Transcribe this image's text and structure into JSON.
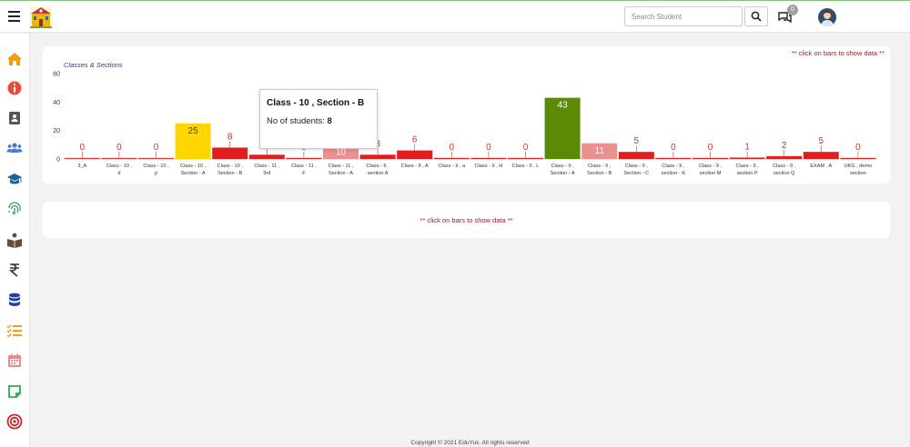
{
  "search": {
    "placeholder": "Search Student"
  },
  "notifications": {
    "count": "0"
  },
  "sidebar": {
    "items": [
      {
        "icon": "home-icon",
        "color": "#f39c12"
      },
      {
        "icon": "info-icon",
        "color": "#e74c3c"
      },
      {
        "icon": "contact-book-icon",
        "color": "#555555"
      },
      {
        "icon": "users-icon",
        "color": "#4a7cc9"
      },
      {
        "icon": "graduation-cap-icon",
        "color": "#1d5f9c"
      },
      {
        "icon": "fingerprint-icon",
        "color": "#2eaa4a"
      },
      {
        "icon": "book-reader-icon",
        "color": "#6b4a3a"
      },
      {
        "icon": "rupee-icon",
        "color": "#333333"
      },
      {
        "icon": "database-icon",
        "color": "#1f3fa6"
      },
      {
        "icon": "checklist-icon",
        "color": "#f0a11c"
      },
      {
        "icon": "calendar-icon",
        "color": "#e88c8c"
      },
      {
        "icon": "sticky-note-icon",
        "color": "#2eaa4a"
      },
      {
        "icon": "target-icon",
        "color": "#c62828"
      }
    ]
  },
  "card1": {
    "hint": "** click on bars to show data **"
  },
  "card2": {
    "hint": "** click on bars to show data **"
  },
  "tooltip": {
    "title": "Class - 10 , Section - B",
    "label": "No of students:",
    "value": "8"
  },
  "footer": {
    "text": "Copyright © 2021 EduYux. All rights reserved"
  },
  "chart_data": {
    "type": "bar",
    "title": "Classes & Sections",
    "ylim": [
      0,
      60
    ],
    "yticks": [
      0,
      20,
      40,
      60
    ],
    "categories": [
      [
        "3_A"
      ],
      [
        "Class - 10 ,",
        "d"
      ],
      [
        "Class - 10 ,",
        "p"
      ],
      [
        "Class - 10 ,",
        "Section - A"
      ],
      [
        "Class - 10 ,",
        "Section - B"
      ],
      [
        "Class - 11 ,",
        "3rd"
      ],
      [
        "Class - 11 ,",
        "F"
      ],
      [
        "Class - 11 ,",
        "Section - A"
      ],
      [
        "Class - 6 ,",
        "section A"
      ],
      [
        "Class - 8 , A"
      ],
      [
        "Class - 9 , a"
      ],
      [
        "Class - 9 , H"
      ],
      [
        "Class - 9 , L"
      ],
      [
        "Class - 9 ,",
        "Section - A"
      ],
      [
        "Class - 9 ,",
        "Section - B"
      ],
      [
        "Class - 9 ,",
        "Section - C"
      ],
      [
        "Class - 9 ,",
        "section - K"
      ],
      [
        "Class - 9 ,",
        "section M"
      ],
      [
        "Class - 9 ,",
        "section P"
      ],
      [
        "Class - 9 ,",
        "section Q"
      ],
      [
        "EXAM , A"
      ],
      [
        "UKG , demo",
        "section"
      ]
    ],
    "values": [
      0,
      0,
      0,
      25,
      8,
      3,
      0,
      10,
      3,
      6,
      0,
      0,
      0,
      43,
      11,
      5,
      0,
      0,
      1,
      2,
      5,
      0
    ],
    "colors": [
      "#e53935",
      "#e53935",
      "#e53935",
      "#ffd600",
      "#e11d1d",
      "#e11d1d",
      "#e11d1d",
      "#eb8f8f",
      "#e11d1d",
      "#e11d1d",
      "#e11d1d",
      "#e11d1d",
      "#e11d1d",
      "#5a8a06",
      "#eb8f8f",
      "#e11d1d",
      "#e11d1d",
      "#e11d1d",
      "#e11d1d",
      "#e11d1d",
      "#e11d1d",
      "#e11d1d"
    ],
    "grid": false,
    "legend": "none"
  }
}
